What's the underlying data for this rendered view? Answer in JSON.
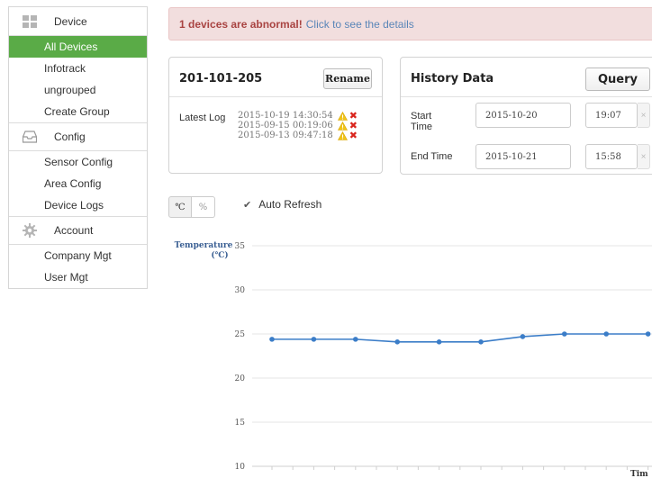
{
  "sidebar": {
    "device": {
      "header": "Device",
      "icon": "grid-icon",
      "items": [
        {
          "label": "All Devices",
          "active": true
        },
        {
          "label": "Infotrack",
          "active": false
        },
        {
          "label": "ungrouped",
          "active": false
        },
        {
          "label": "Create Group",
          "active": false
        }
      ]
    },
    "config": {
      "header": "Config",
      "icon": "inbox-icon",
      "items": [
        {
          "label": "Sensor Config"
        },
        {
          "label": "Area Config"
        },
        {
          "label": "Device Logs"
        }
      ]
    },
    "account": {
      "header": "Account",
      "icon": "gear-icon",
      "items": [
        {
          "label": "Company Mgt"
        },
        {
          "label": "User Mgt"
        }
      ]
    }
  },
  "alert": {
    "message": "1 devices are abnormal!",
    "link": "Click to see the details"
  },
  "device_panel": {
    "title": "201-101-205",
    "rename_label": "Rename",
    "latest_log_label": "Latest Log",
    "logs": [
      "2015-10-19 14:30:54",
      "2015-09-15 00:19:06",
      "2015-09-13 09:47:18"
    ]
  },
  "history_panel": {
    "title": "History Data",
    "query_label": "Query",
    "start_label": "Start Time",
    "start_date": "2015-10-20",
    "start_time": "19:07",
    "end_label": "End Time",
    "end_date": "2015-10-21",
    "end_time": "15:58",
    "clear_symbol": "×"
  },
  "unit_toggle": {
    "celsius": "℃",
    "percent": "%"
  },
  "auto_refresh": {
    "label": "Auto Refresh",
    "checked": true
  },
  "colors": {
    "accent": "#5aab47",
    "line": "#3b7dc8",
    "alert_bg": "#f2dede",
    "alert_text": "#a94442",
    "link": "#5a86b8",
    "error": "#d9251d",
    "warning": "#f0c419"
  },
  "chart_data": {
    "type": "line",
    "ylabel": "Temperature (℃)",
    "xlabel": "Tim",
    "ylim": [
      10,
      35
    ],
    "yticks": [
      35,
      30,
      25,
      20,
      15,
      10
    ],
    "grid": true,
    "series": [
      {
        "values": [
          24.4,
          24.4,
          24.4,
          24.1,
          24.1,
          24.1,
          24.7,
          25.0,
          25.0,
          25.0
        ]
      }
    ]
  }
}
